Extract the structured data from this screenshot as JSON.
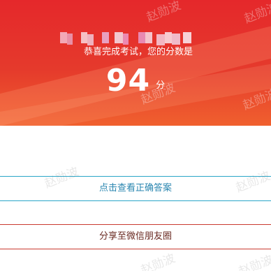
{
  "result": {
    "congrats_text": "恭喜完成考试，您的分数是",
    "score": "94",
    "score_unit": "分"
  },
  "actions": {
    "view_answers_label": "点击查看正确答案",
    "share_label": "分享至微信朋友圈"
  },
  "watermark": {
    "text": "赵勋波"
  },
  "colors": {
    "banner_top": "#e5282b",
    "banner_bottom": "#f0602e",
    "answers_border": "#2aa6c8",
    "answers_text": "#2a86b0",
    "share_border": "#c93a30",
    "share_text": "#6a2a22"
  }
}
